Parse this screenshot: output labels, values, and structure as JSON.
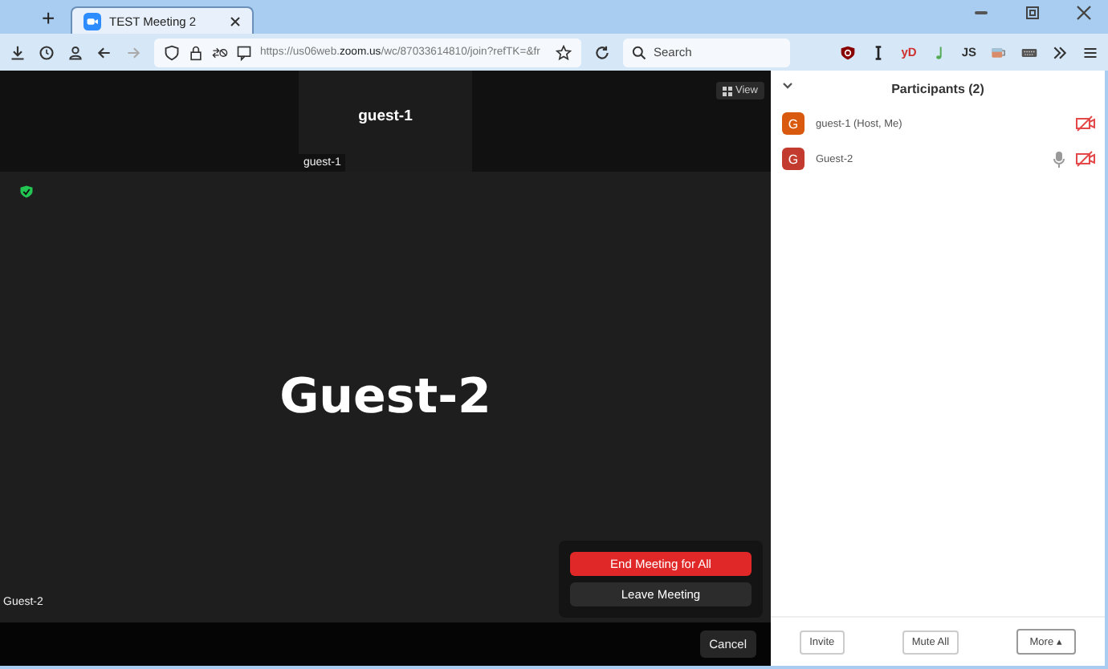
{
  "browser": {
    "tab": {
      "title": "TEST Meeting 2",
      "selected": true
    },
    "new_tab": "+",
    "url": "https://us06web.**zoom.us**/wc/87033614810/join?refTK=&fr",
    "search": {
      "placeholder": "Search"
    },
    "extensions": [
      {
        "kind": "shield"
      },
      {
        "kind": "cursor"
      },
      {
        "kind": "text",
        "text": "yD",
        "color": "#d0302f"
      },
      {
        "kind": "note"
      },
      {
        "kind": "text",
        "text": "JS",
        "color": "#333333"
      },
      {
        "kind": "cup"
      },
      {
        "kind": "keyboard"
      }
    ]
  },
  "meeting": {
    "view_button": "View",
    "thumbnail": {
      "name": "guest-1",
      "label": "guest-1"
    },
    "main_speaker": {
      "name": "Guest-2",
      "label": "Guest-2"
    },
    "end_dialog": {
      "buttons": [
        {
          "label": "End Meeting for All",
          "kind": "danger"
        },
        {
          "label": "Leave Meeting",
          "kind": "normal"
        }
      ],
      "cancel": "Cancel"
    }
  },
  "participants": {
    "title": "Participants (2)",
    "items": [
      {
        "name": "guest-1 (Host, Me)",
        "initial": "G",
        "color": "#d95a0f",
        "mic_shown": false,
        "video_muted": true
      },
      {
        "name": "Guest-2",
        "initial": "G",
        "color": "#c23b2e",
        "mic_shown": true,
        "video_muted": true
      }
    ],
    "buttons": [
      {
        "label": "Invite",
        "kind": "plain"
      },
      {
        "label": "Mute All",
        "kind": "plain"
      },
      {
        "label": "More ▴",
        "kind": "menu"
      }
    ]
  }
}
